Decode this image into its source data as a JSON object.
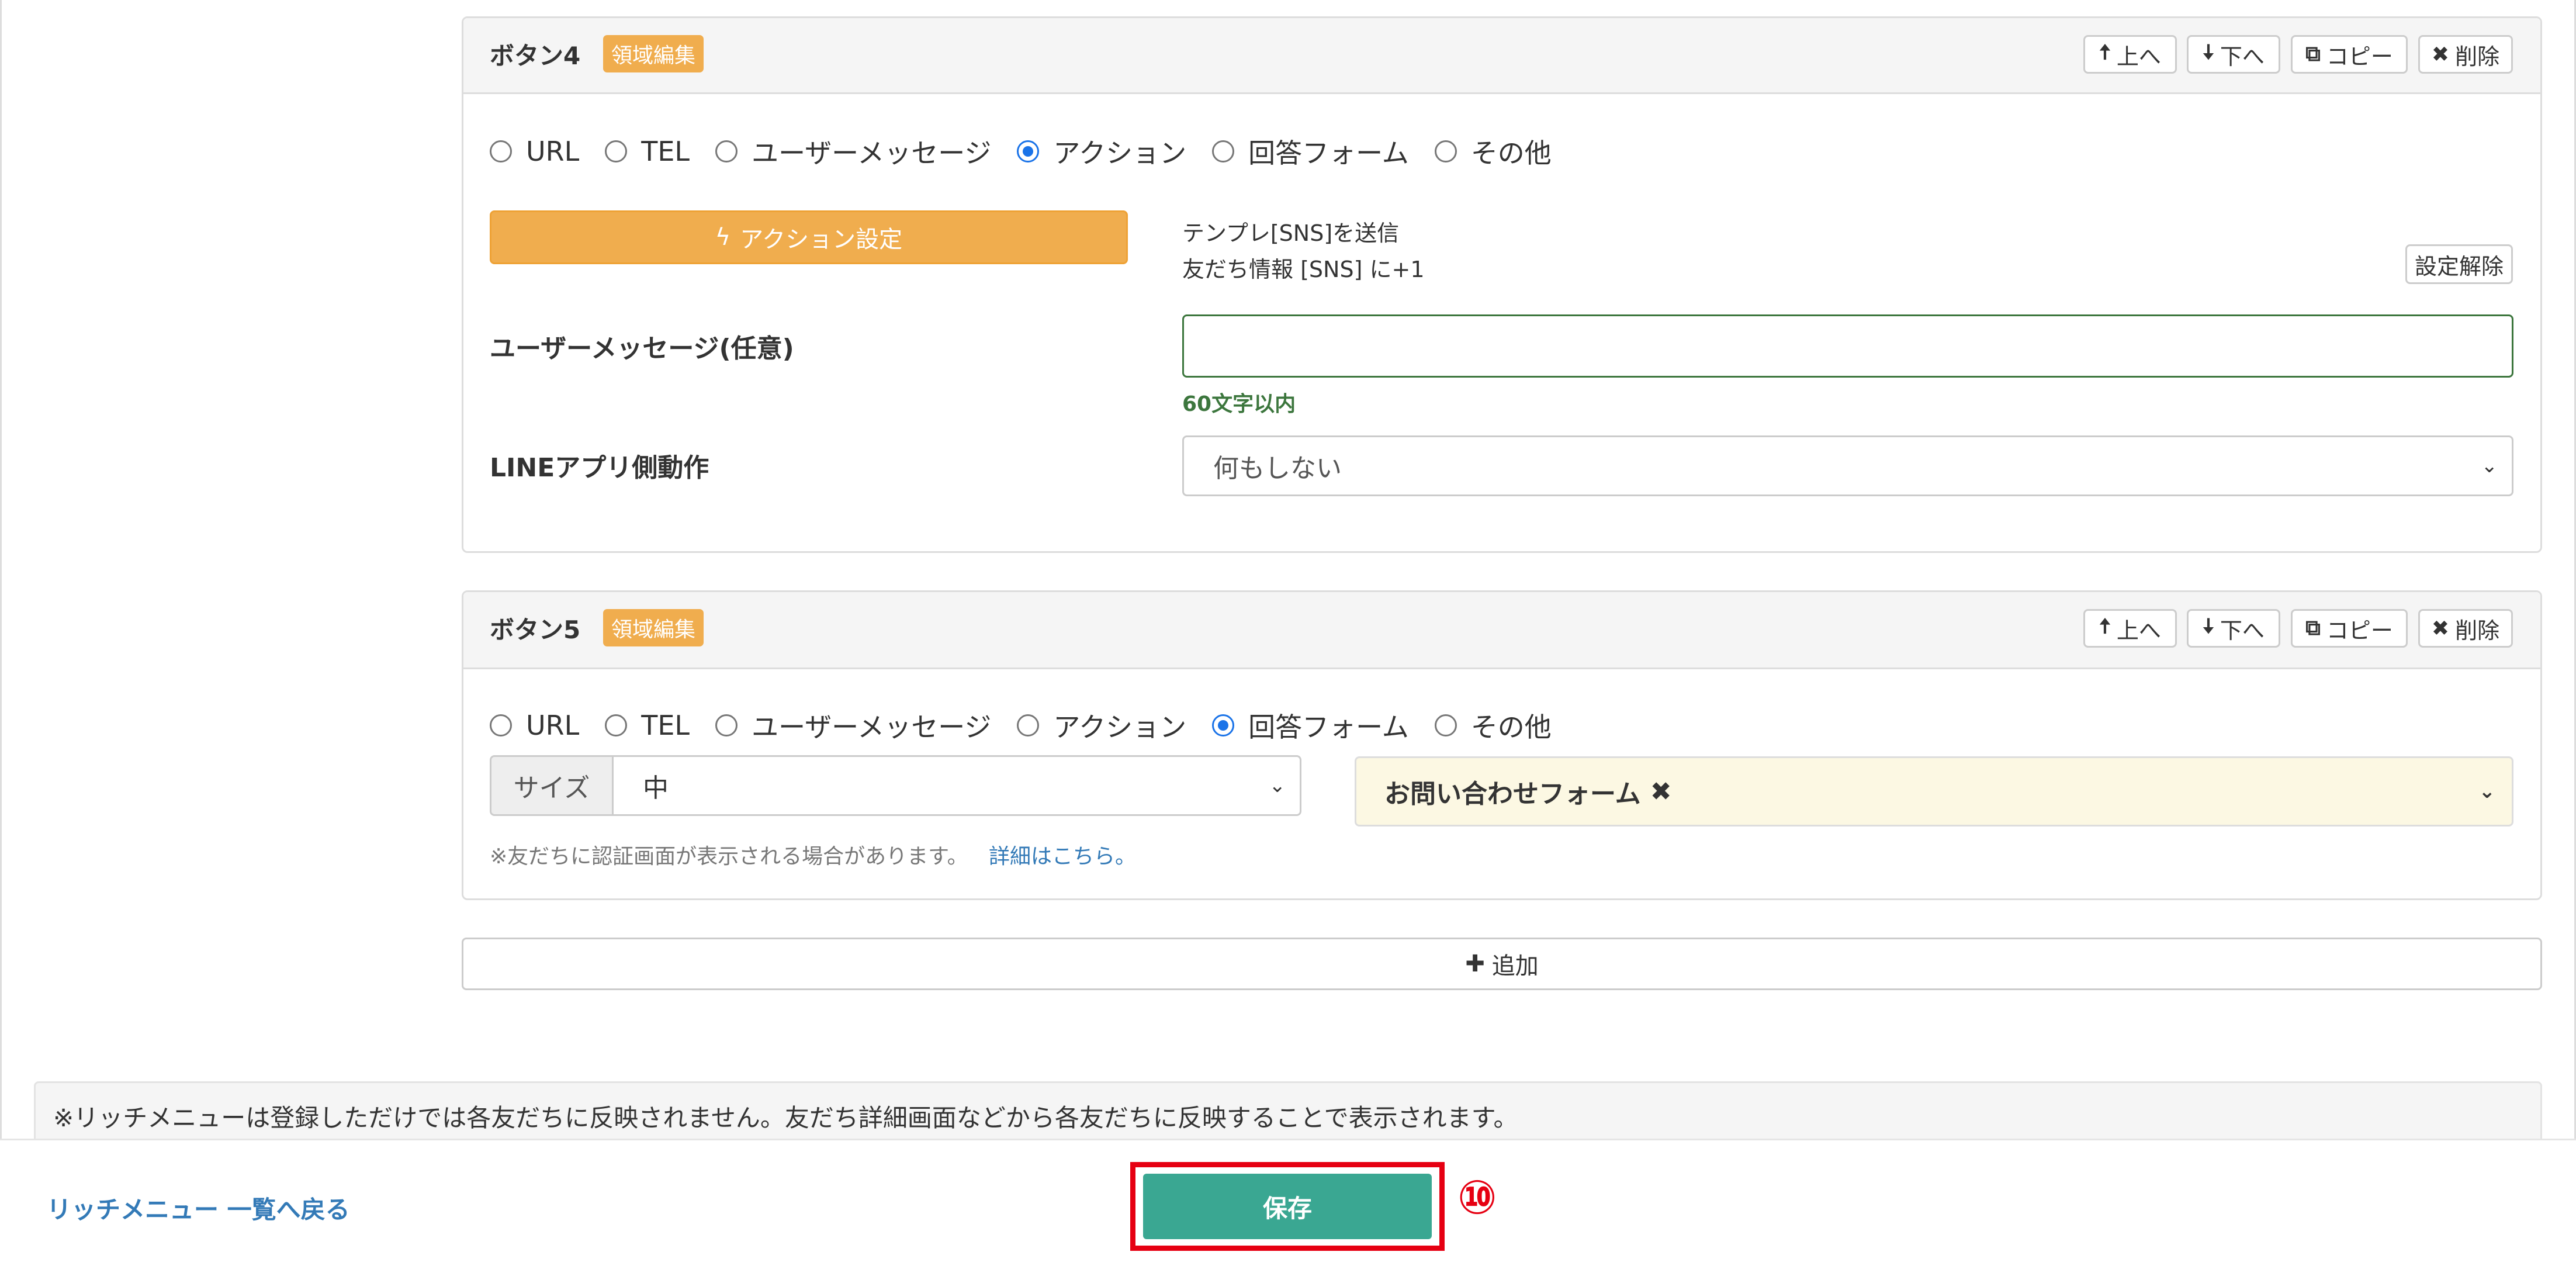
{
  "button4": {
    "title": "ボタン4",
    "badge": "領域編集",
    "controls": {
      "up": "上へ",
      "down": "下へ",
      "copy": "コピー",
      "delete": "削除"
    },
    "radios": [
      {
        "label": "URL",
        "checked": false
      },
      {
        "label": "TEL",
        "checked": false
      },
      {
        "label": "ユーザーメッセージ",
        "checked": false
      },
      {
        "label": "アクション",
        "checked": true
      },
      {
        "label": "回答フォーム",
        "checked": false
      },
      {
        "label": "その他",
        "checked": false
      }
    ],
    "action_button": "アクション設定",
    "action_summary_line1": "テンプレ[SNS]を送信",
    "action_summary_line2": "友だち情報 [SNS] に+1",
    "clear_settings": "設定解除",
    "user_message_label": "ユーザーメッセージ(任意)",
    "user_message_value": "",
    "user_message_help": "60文字以内",
    "line_app_label": "LINEアプリ側動作",
    "line_app_value": "何もしない"
  },
  "button5": {
    "title": "ボタン5",
    "badge": "領域編集",
    "controls": {
      "up": "上へ",
      "down": "下へ",
      "copy": "コピー",
      "delete": "削除"
    },
    "radios": [
      {
        "label": "URL",
        "checked": false
      },
      {
        "label": "TEL",
        "checked": false
      },
      {
        "label": "ユーザーメッセージ",
        "checked": false
      },
      {
        "label": "アクション",
        "checked": false
      },
      {
        "label": "回答フォーム",
        "checked": true
      },
      {
        "label": "その他",
        "checked": false
      }
    ],
    "size_label": "サイズ",
    "size_value": "中",
    "form_name": "お問い合わせフォーム",
    "note": "※友だちに認証画面が表示される場合があります。",
    "note_link": "詳細はこちら。"
  },
  "add_button": "追加",
  "notice": "※リッチメニューは登録しただけでは各友だちに反映されません。友だち詳細画面などから各友だちに反映することで表示されます。",
  "footer": {
    "back_link": "リッチメニュー 一覧へ戻る",
    "save": "保存",
    "step_marker": "⑩"
  },
  "colors": {
    "accent_orange": "#f0ad4e",
    "save_green": "#3aa792",
    "highlight_red": "#e60012",
    "link_blue": "#337ab7",
    "radio_blue": "#1a73e8"
  }
}
